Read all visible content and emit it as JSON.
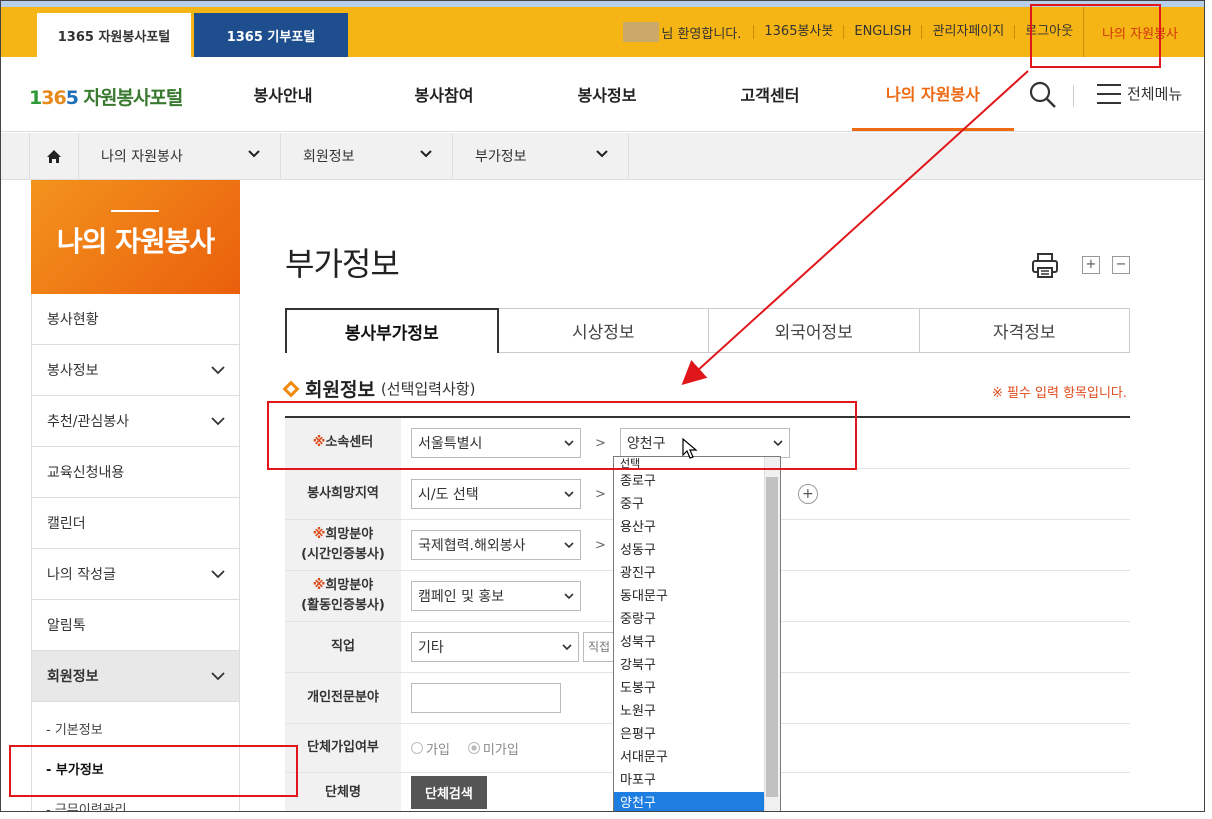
{
  "topbar": {
    "portal_tabs": [
      "1365 자원봉사포털",
      "1365 기부포털"
    ],
    "welcome": "님 환영합니다.",
    "links": [
      "1365봉사봇",
      "ENGLISH",
      "관리자페이지",
      "로그아웃"
    ],
    "my_volunteer": "나의 자원봉사"
  },
  "gnb": {
    "logo": {
      "n1": "1",
      "n2": "36",
      "n3": "5",
      "text": " 자원봉사포털"
    },
    "items": [
      "봉사안내",
      "봉사참여",
      "봉사정보",
      "고객센터",
      "나의 자원봉사"
    ],
    "all_menu": "전체메뉴"
  },
  "breadcrumb": [
    "나의 자원봉사",
    "회원정보",
    "부가정보"
  ],
  "sidebar": {
    "title": "나의 자원봉사",
    "items": [
      "봉사현황",
      "봉사정보",
      "추천/관심봉사",
      "교육신청내용",
      "캘린더",
      "나의 작성글",
      "알림톡",
      "회원정보"
    ],
    "sub_items": [
      "- 기본정보",
      "- 부가정보",
      "- 근무이력관리"
    ]
  },
  "content": {
    "page_title": "부가정보",
    "zoom_in": "+",
    "zoom_out": "−",
    "tabs": [
      "봉사부가정보",
      "시상정보",
      "외국어정보",
      "자격정보"
    ],
    "section_title": "회원정보",
    "section_sub": "(선택입력사항)",
    "required_note": "※ 필수 입력 항목입니다."
  },
  "form": {
    "center": {
      "mark": "※",
      "label": "소속센터",
      "sido": "서울특별시",
      "gu": "양천구"
    },
    "region": {
      "label": "봉사희망지역",
      "sido": "시/도 선택"
    },
    "field1": {
      "mark": "※",
      "label1": "희망분야",
      "label2": "(시간인증봉사)",
      "value": "국제협력.해외봉사"
    },
    "field2": {
      "mark": "※",
      "label1": "희망분야",
      "label2": "(활동인증봉사)",
      "value": "캠페인 및 홍보"
    },
    "job": {
      "label": "직업",
      "value": "기타",
      "placeholder": "직접"
    },
    "expert": {
      "label": "개인전문분야"
    },
    "group_join": {
      "label": "단체가입여부",
      "options": [
        "가입",
        "미가입"
      ],
      "selected": "미가입"
    },
    "group_name": {
      "label": "단체명",
      "button": "단체검색"
    },
    "separator": ">"
  },
  "dropdown": {
    "items": [
      "선택",
      "종로구",
      "중구",
      "용산구",
      "성동구",
      "광진구",
      "동대문구",
      "중랑구",
      "성북구",
      "강북구",
      "도봉구",
      "노원구",
      "은평구",
      "서대문구",
      "마포구",
      "양천구"
    ],
    "selected": "양천구"
  },
  "colors": {
    "accent": "#ee6a12",
    "topbar": "#f5b514",
    "annotation": "#e0161b",
    "selection": "#1e7de0"
  }
}
